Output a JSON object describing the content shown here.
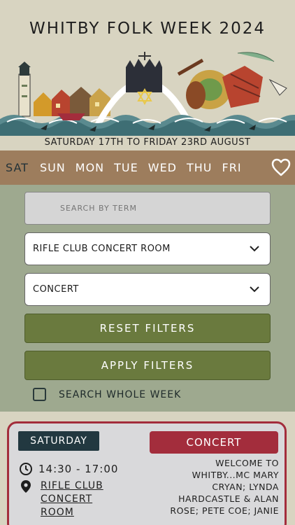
{
  "header": {
    "title": "WHITBY FOLK WEEK 2024",
    "dates": "SATURDAY 17TH TO FRIDAY 23RD AUGUST"
  },
  "days": {
    "items": [
      "SAT",
      "SUN",
      "MON",
      "TUE",
      "WED",
      "THU",
      "FRI"
    ],
    "selected": "SAT"
  },
  "filters": {
    "search_placeholder": "SEARCH BY TERM",
    "venue_value": "RIFLE CLUB CONCERT ROOM",
    "type_value": "CONCERT",
    "reset_label": "RESET FILTERS",
    "apply_label": "APPLY FILTERS",
    "whole_week_label": "SEARCH WHOLE WEEK"
  },
  "event": {
    "day": "SATURDAY",
    "type": "CONCERT",
    "time": "14:30 - 17:00",
    "venue": "RIFLE CLUB CONCERT ROOM",
    "description": "WELCOME TO WHITBY...MC MARY CRYAN; LYNDA HARDCASTLE & ALAN ROSE; PETE COE; JANIE"
  },
  "colors": {
    "background": "#d8d4c1",
    "day_bar": "#9d7d5d",
    "filter_panel": "#9ea98f",
    "button": "#6a7a3e",
    "accent_red": "#a32d3c",
    "day_tag": "#223840"
  },
  "icons": [
    "heart-icon",
    "chevron-down-icon",
    "clock-icon",
    "location-pin-icon"
  ]
}
